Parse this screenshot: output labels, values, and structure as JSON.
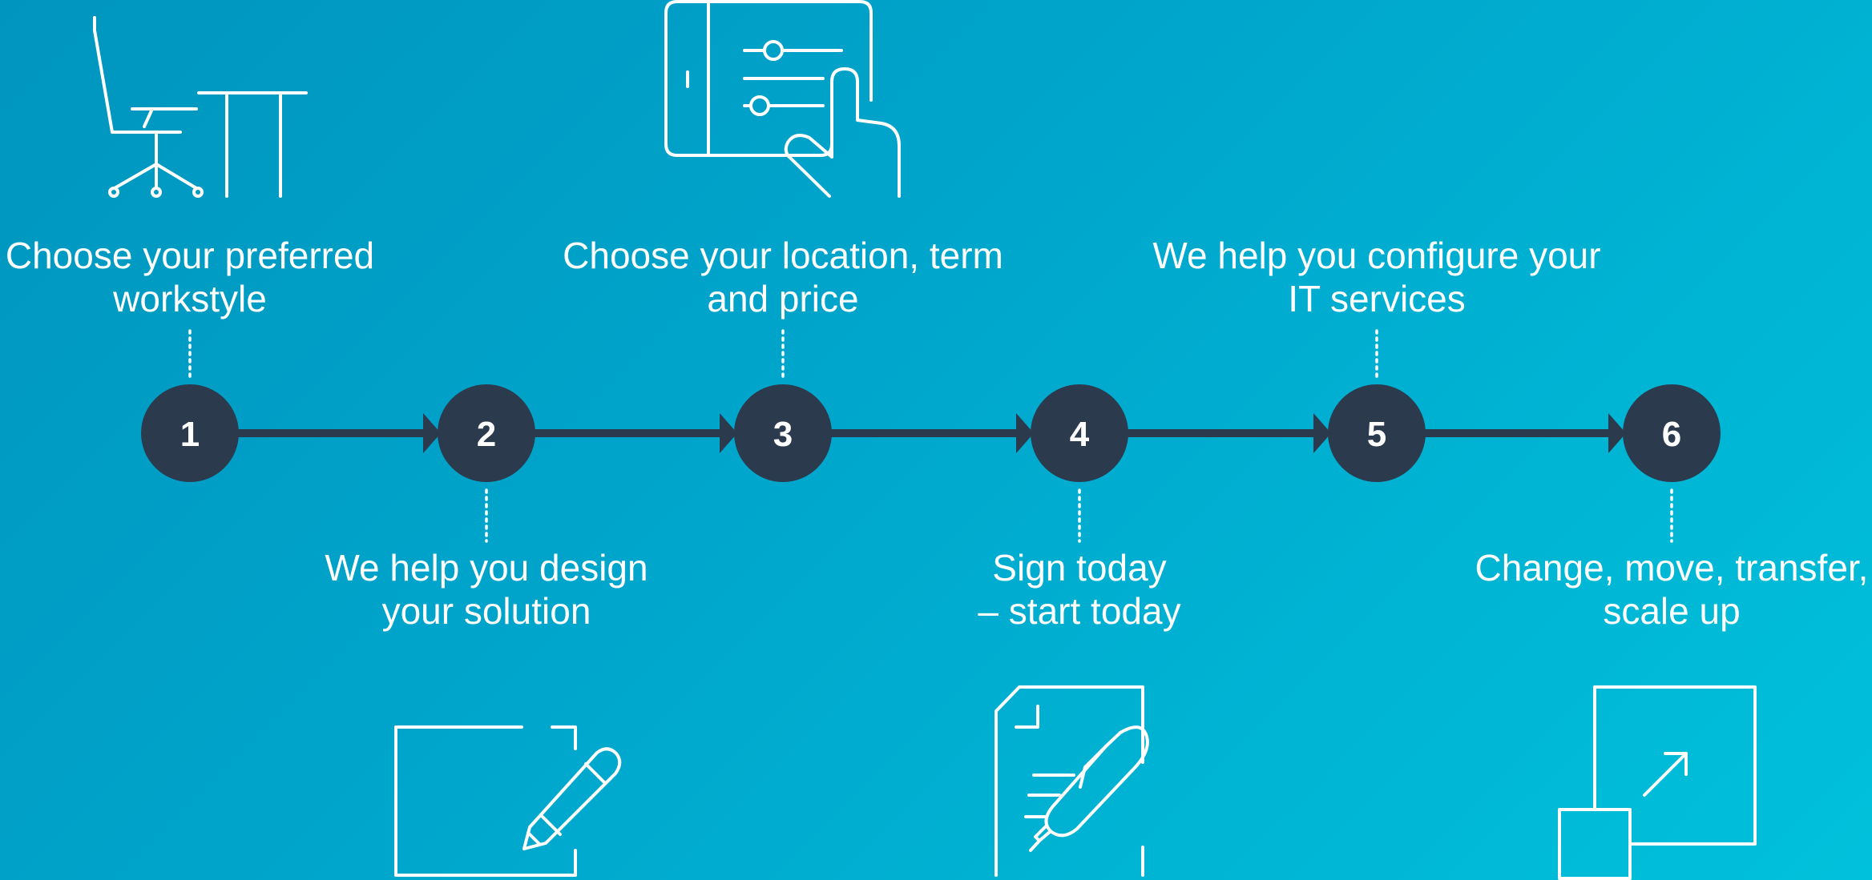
{
  "colors": {
    "circle": "#2c3a4e",
    "arrow": "#2c3a4e",
    "line": "#ffffff",
    "text": "#ffffff"
  },
  "steps": [
    {
      "number": "1",
      "lines": [
        "Choose your preferred",
        "workstyle"
      ],
      "label_side": "top",
      "icon": "chair-desk-icon"
    },
    {
      "number": "2",
      "lines": [
        "We help you design",
        "your solution"
      ],
      "label_side": "bottom",
      "icon": "frame-pencil-icon"
    },
    {
      "number": "3",
      "lines": [
        "Choose your location, term",
        "and price"
      ],
      "label_side": "top",
      "icon": "tablet-sliders-icon"
    },
    {
      "number": "4",
      "lines": [
        "Sign today",
        "– start today"
      ],
      "label_side": "bottom",
      "icon": "document-pen-icon"
    },
    {
      "number": "5",
      "lines": [
        "We help you configure your",
        "IT services"
      ],
      "label_side": "top",
      "icon": ""
    },
    {
      "number": "6",
      "lines": [
        "Change, move, transfer,",
        "scale up"
      ],
      "label_side": "bottom",
      "icon": "scale-up-icon"
    }
  ]
}
